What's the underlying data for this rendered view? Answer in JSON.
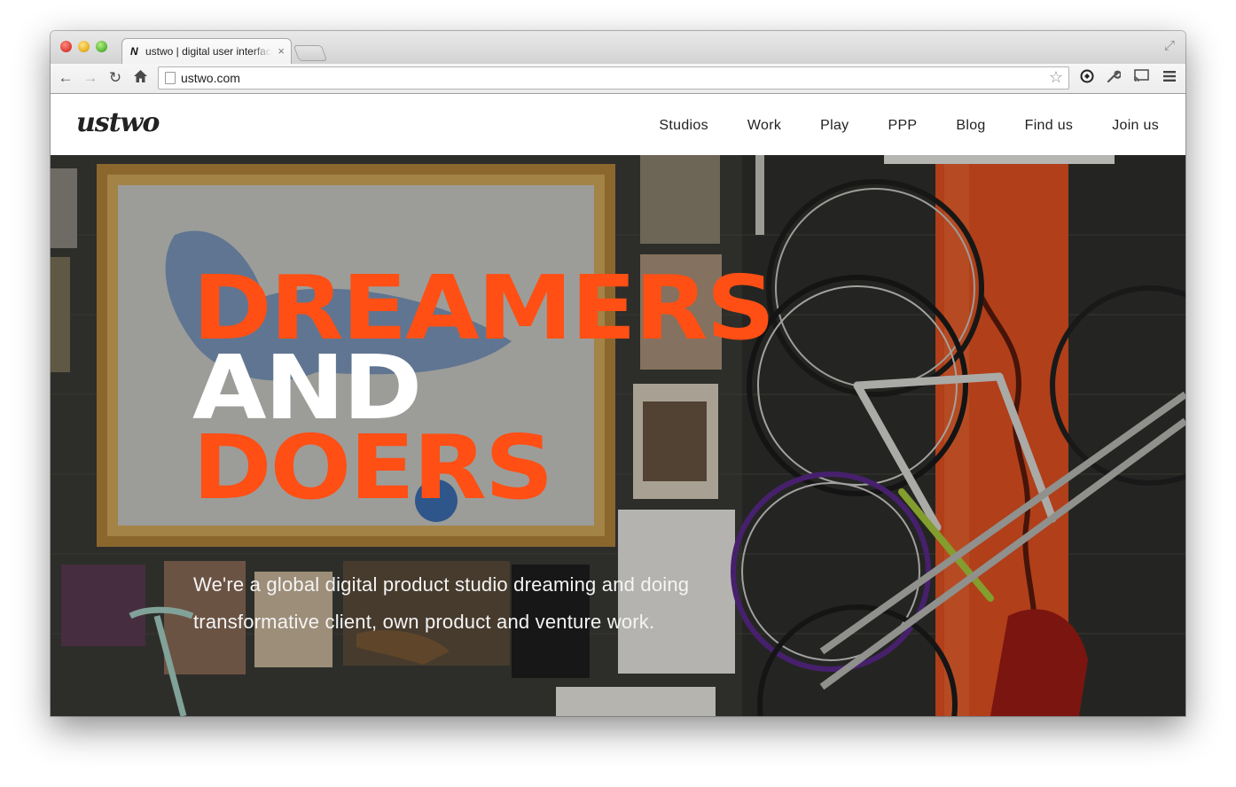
{
  "browser": {
    "tab_title": "ustwo | digital user interface",
    "tab_close": "×",
    "url": "ustwo.com",
    "icons": [
      "back-icon",
      "forward-icon",
      "reload-icon",
      "home-icon",
      "page-icon",
      "star-icon",
      "chrome-extension-icon",
      "wrench-icon",
      "cast-icon",
      "menu-icon",
      "fullscreen-icon"
    ]
  },
  "site": {
    "logo": "ustwo",
    "nav": [
      "Studios",
      "Work",
      "Play",
      "PPP",
      "Blog",
      "Find us",
      "Join us"
    ]
  },
  "hero": {
    "line1": "DREAMERS",
    "line2": "AND",
    "line3": "DOERS",
    "tagline": "We're a global digital product studio dreaming and doing transformative client, own product and venture work.",
    "colors": {
      "accent": "#ff4f15",
      "white": "#ffffff"
    }
  }
}
